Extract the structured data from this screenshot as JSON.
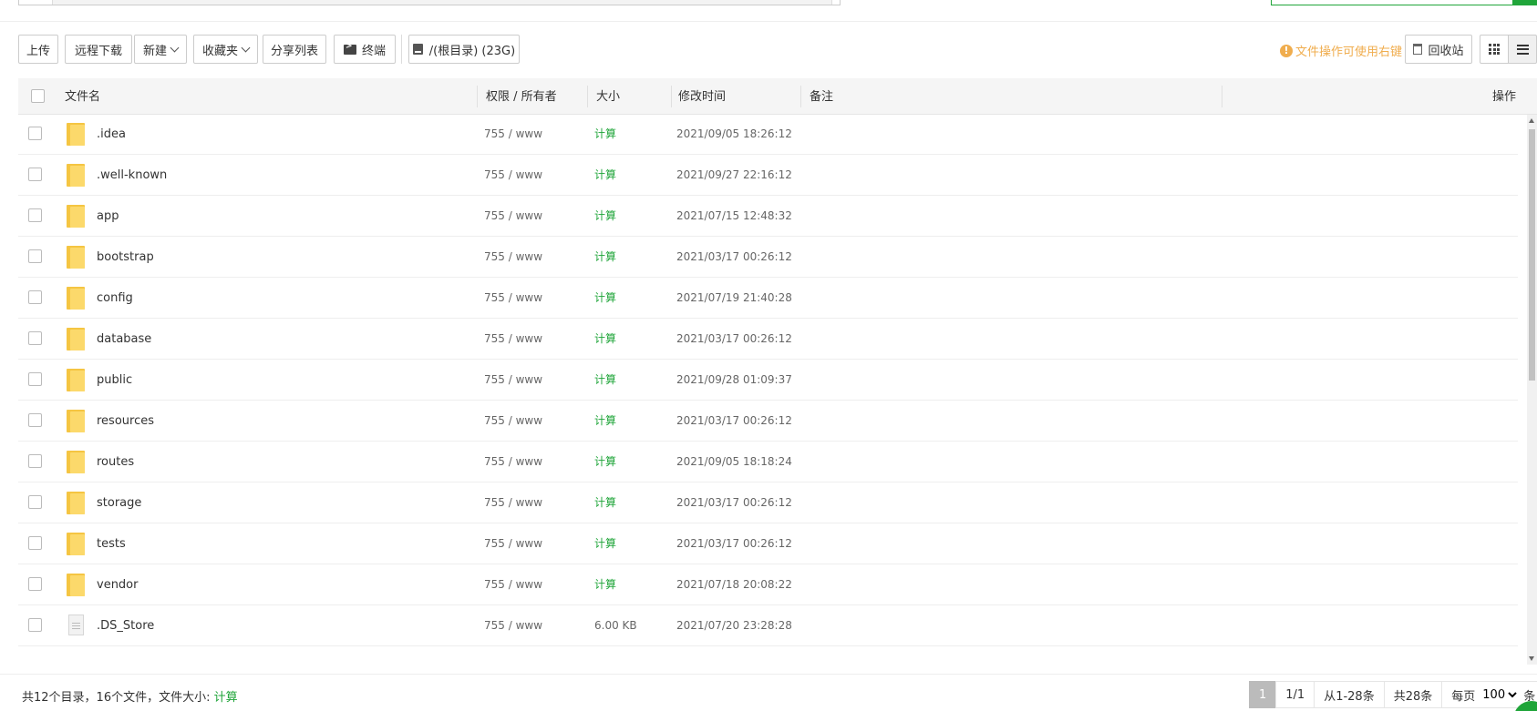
{
  "toolbar": {
    "upload": "上传",
    "remote_download": "远程下载",
    "new": "新建",
    "favorites": "收藏夹",
    "share_list": "分享列表",
    "terminal": "终端",
    "disk": "/(根目录) (23G)",
    "hint": "文件操作可使用右键",
    "recycle_bin": "回收站"
  },
  "table": {
    "headers": {
      "name": "文件名",
      "perm_owner": "权限 / 所有者",
      "size": "大小",
      "mtime": "修改时间",
      "remark": "备注",
      "ops": "操作"
    },
    "rows": [
      {
        "type": "folder",
        "name": ".idea",
        "perm": "755 / www",
        "size": "计算",
        "mtime": "2021/09/05 18:26:12"
      },
      {
        "type": "folder",
        "name": ".well-known",
        "perm": "755 / www",
        "size": "计算",
        "mtime": "2021/09/27 22:16:12"
      },
      {
        "type": "folder",
        "name": "app",
        "perm": "755 / www",
        "size": "计算",
        "mtime": "2021/07/15 12:48:32"
      },
      {
        "type": "folder",
        "name": "bootstrap",
        "perm": "755 / www",
        "size": "计算",
        "mtime": "2021/03/17 00:26:12"
      },
      {
        "type": "folder",
        "name": "config",
        "perm": "755 / www",
        "size": "计算",
        "mtime": "2021/07/19 21:40:28"
      },
      {
        "type": "folder",
        "name": "database",
        "perm": "755 / www",
        "size": "计算",
        "mtime": "2021/03/17 00:26:12"
      },
      {
        "type": "folder",
        "name": "public",
        "perm": "755 / www",
        "size": "计算",
        "mtime": "2021/09/28 01:09:37"
      },
      {
        "type": "folder",
        "name": "resources",
        "perm": "755 / www",
        "size": "计算",
        "mtime": "2021/03/17 00:26:12"
      },
      {
        "type": "folder",
        "name": "routes",
        "perm": "755 / www",
        "size": "计算",
        "mtime": "2021/09/05 18:18:24"
      },
      {
        "type": "folder",
        "name": "storage",
        "perm": "755 / www",
        "size": "计算",
        "mtime": "2021/03/17 00:26:12"
      },
      {
        "type": "folder",
        "name": "tests",
        "perm": "755 / www",
        "size": "计算",
        "mtime": "2021/03/17 00:26:12"
      },
      {
        "type": "folder",
        "name": "vendor",
        "perm": "755 / www",
        "size": "计算",
        "mtime": "2021/07/18 20:08:22"
      },
      {
        "type": "file",
        "name": ".DS_Store",
        "perm": "755 / www",
        "size": "6.00 KB",
        "mtime": "2021/07/20 23:28:28"
      }
    ]
  },
  "footer": {
    "summary": "共12个目录，16个文件，文件大小:",
    "calc": "计算",
    "page_current": "1",
    "page_total": "1/1",
    "range": "从1-28条",
    "total": "共28条",
    "per_page_label": "每页",
    "per_page_value": "100",
    "per_page_unit": "条"
  }
}
